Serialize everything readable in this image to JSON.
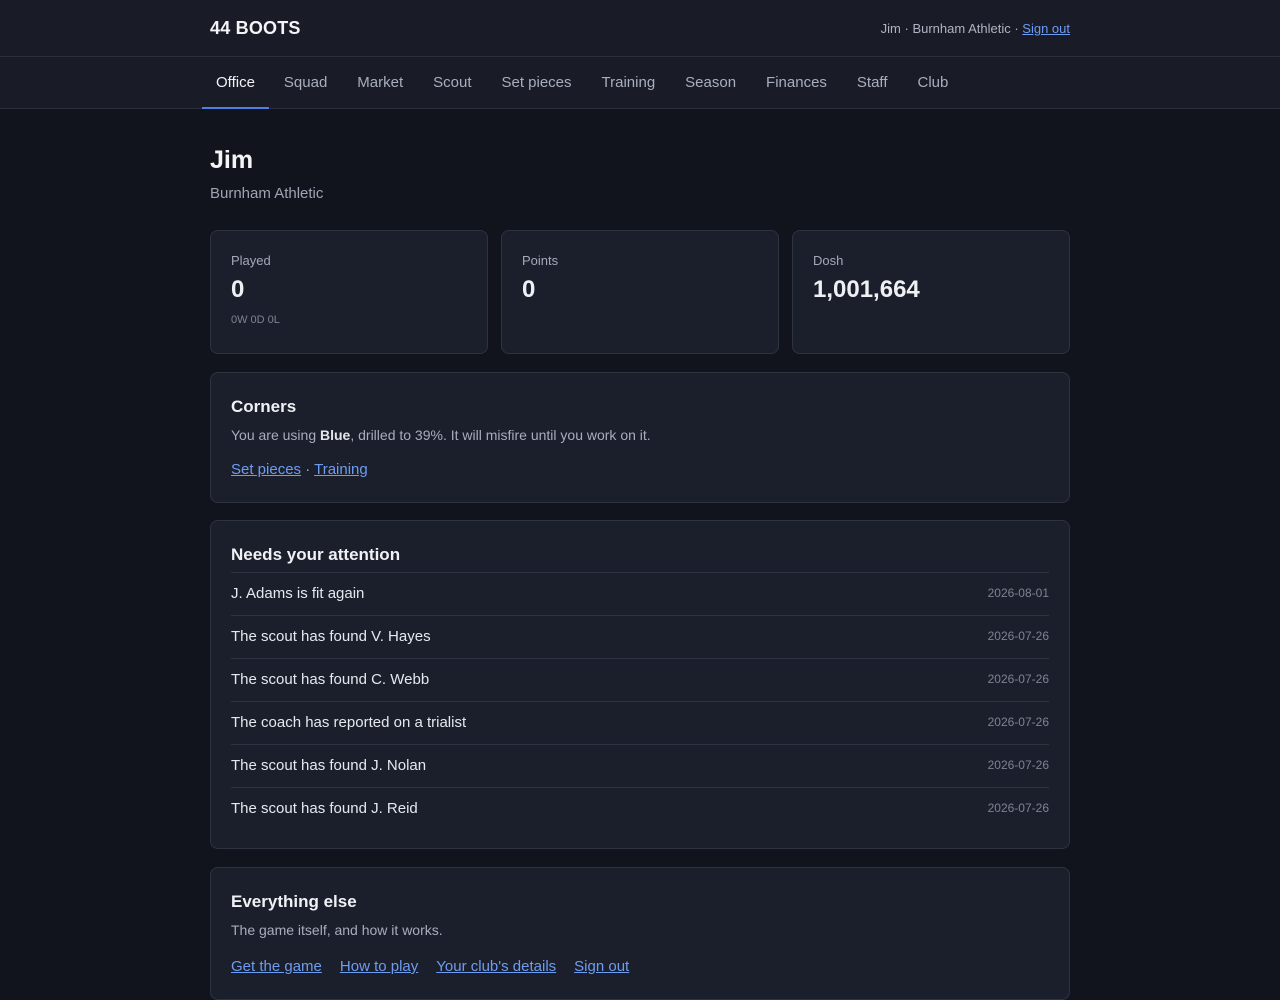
{
  "header": {
    "brand": "44 BOOTS",
    "user_info": "Jim · Burnham Athletic ·",
    "sign_out": "Sign out"
  },
  "nav": {
    "tabs": [
      {
        "label": "Office",
        "active": true
      },
      {
        "label": "Squad"
      },
      {
        "label": "Market"
      },
      {
        "label": "Scout"
      },
      {
        "label": "Set pieces"
      },
      {
        "label": "Training"
      },
      {
        "label": "Season"
      },
      {
        "label": "Finances"
      },
      {
        "label": "Staff"
      },
      {
        "label": "Club"
      }
    ]
  },
  "page": {
    "title": "Jim",
    "subtitle": "Burnham Athletic"
  },
  "stats": {
    "played": {
      "label": "Played",
      "value": "0",
      "sub": "0W 0D 0L"
    },
    "points": {
      "label": "Points",
      "value": "0"
    },
    "dosh": {
      "label": "Dosh",
      "value": "1,001,664"
    }
  },
  "corners": {
    "title": "Corners",
    "text_before": "You are using ",
    "routine": "Blue",
    "text_after": ", drilled to 39%. It will misfire until you work on it.",
    "link_set_pieces": "Set pieces",
    "separator": " · ",
    "link_training": "Training"
  },
  "attention": {
    "title": "Needs your attention",
    "items": [
      {
        "text": "J. Adams is fit again",
        "date": "2026-08-01"
      },
      {
        "text": "The scout has found V. Hayes",
        "date": "2026-07-26"
      },
      {
        "text": "The scout has found C. Webb",
        "date": "2026-07-26"
      },
      {
        "text": "The coach has reported on a trialist",
        "date": "2026-07-26"
      },
      {
        "text": "The scout has found J. Nolan",
        "date": "2026-07-26"
      },
      {
        "text": "The scout has found J. Reid",
        "date": "2026-07-26"
      }
    ]
  },
  "everything_else": {
    "title": "Everything else",
    "subtitle": "The game itself, and how it works.",
    "links": [
      "Get the game",
      "How to play",
      "Your club's details",
      "Sign out"
    ]
  }
}
